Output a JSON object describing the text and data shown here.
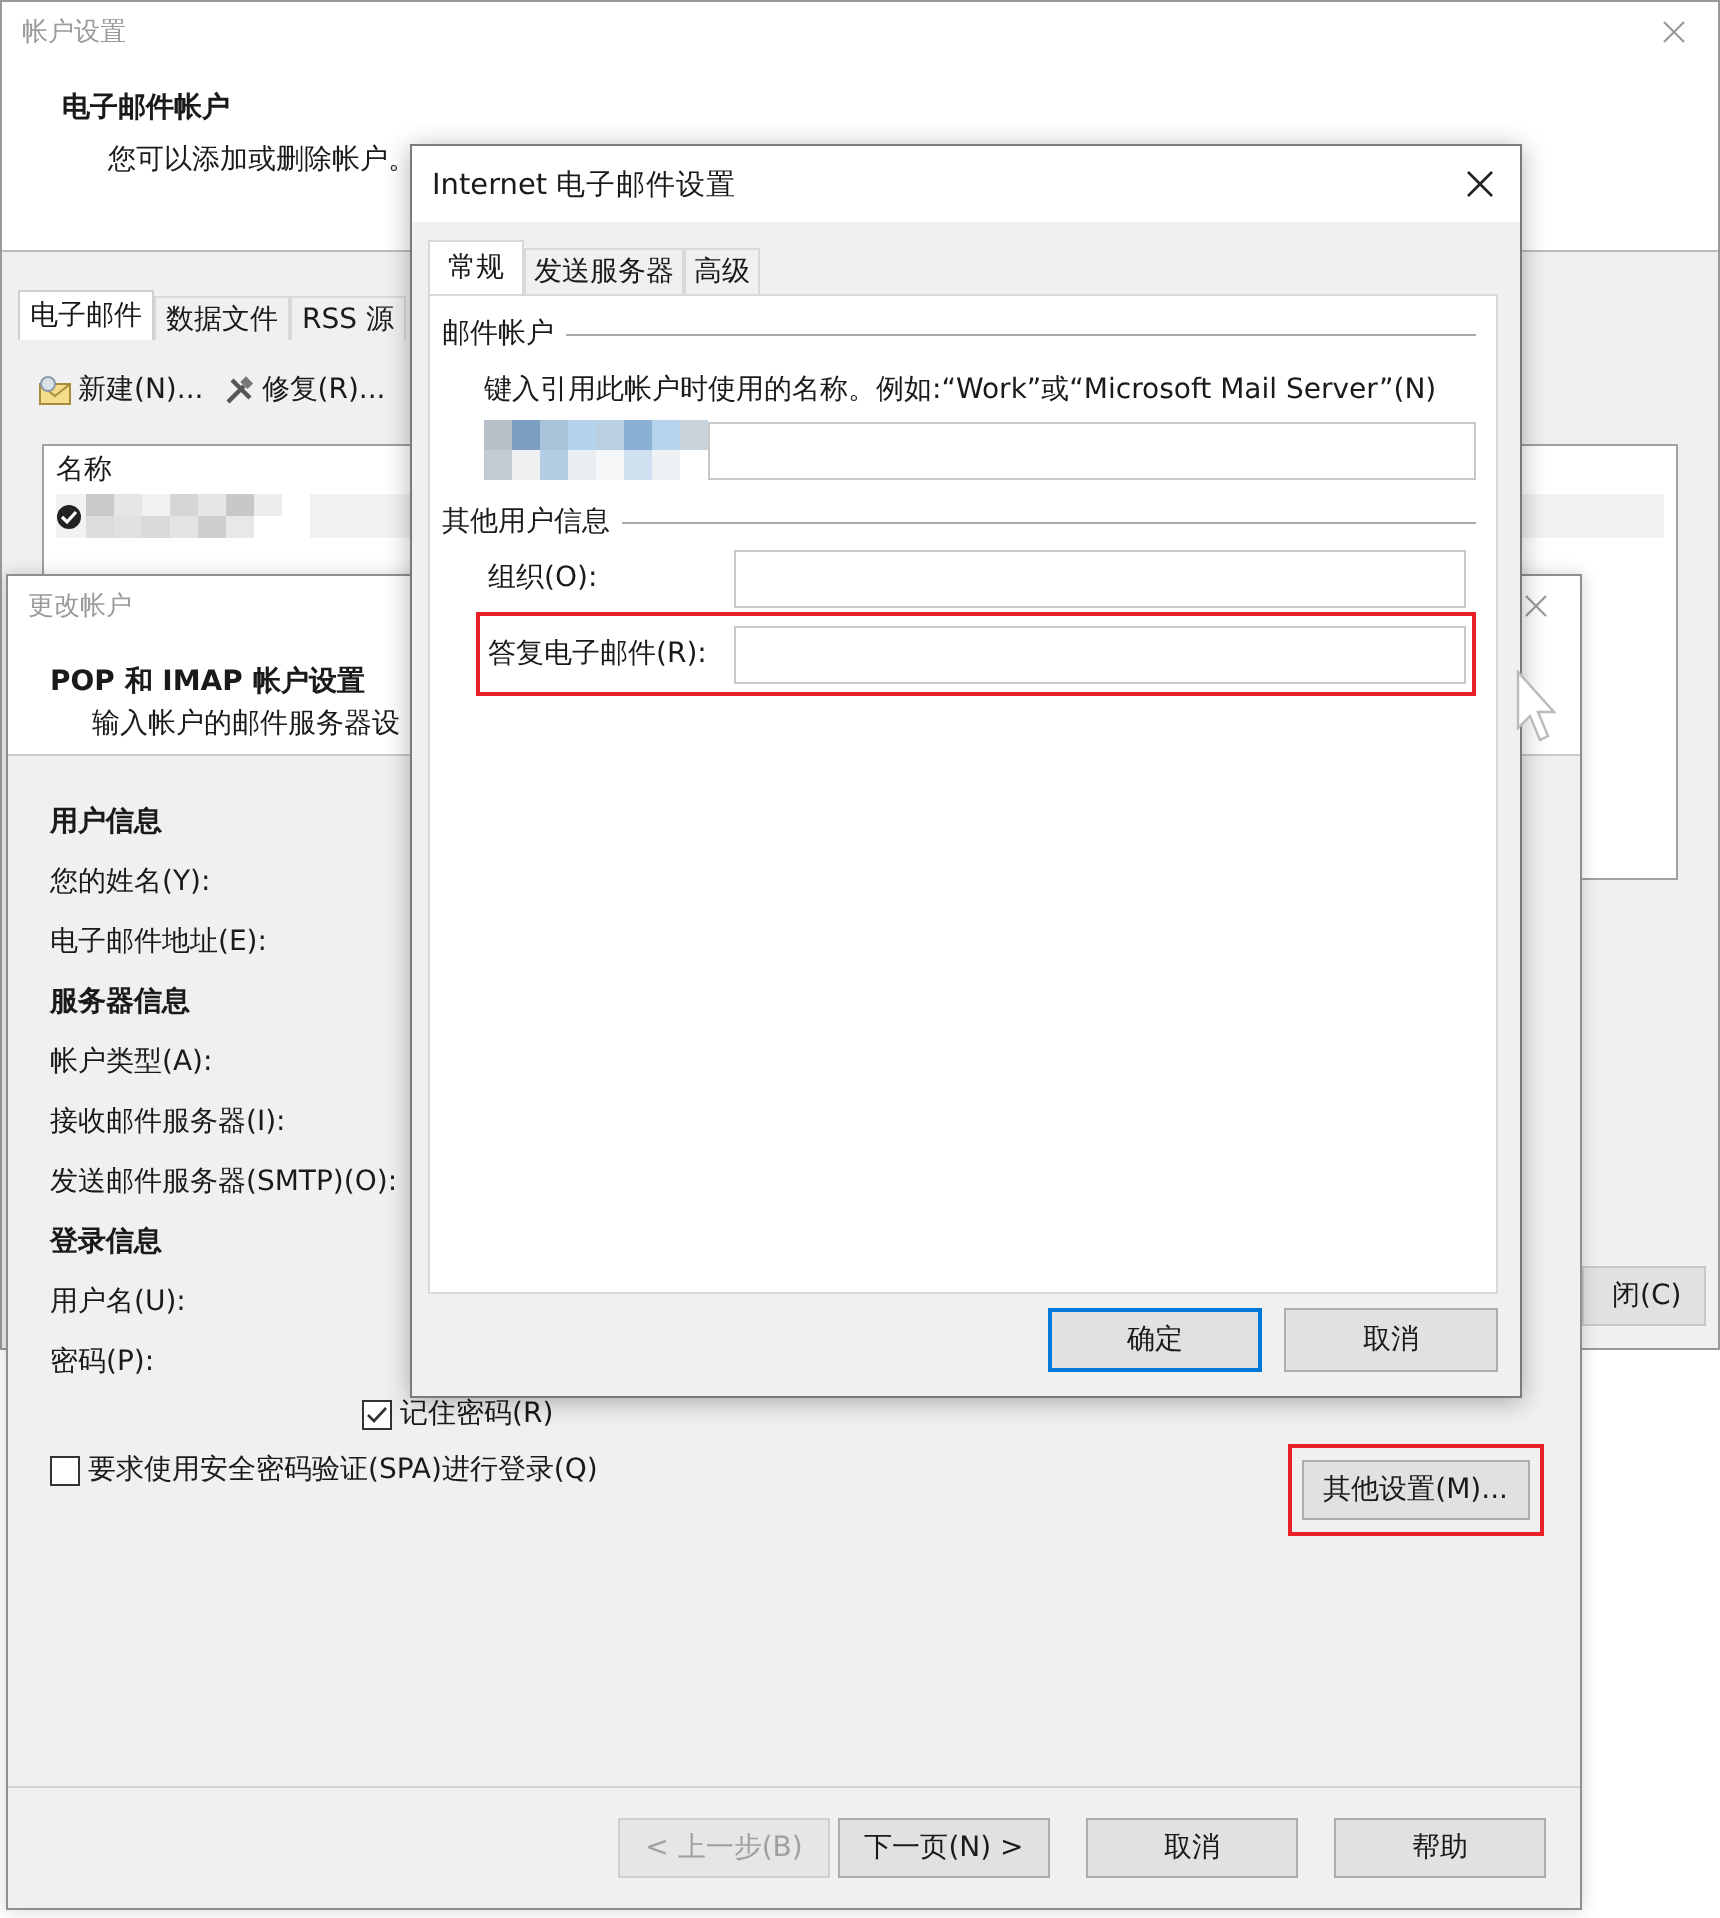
{
  "account_settings": {
    "title": "帐户设置",
    "heading": "电子邮件帐户",
    "subheading": "您可以添加或删除帐户。",
    "tabs": [
      {
        "label": "电子邮件",
        "selected": true
      },
      {
        "label": "数据文件",
        "selected": false
      },
      {
        "label": "RSS 源",
        "selected": false
      }
    ],
    "toolbar": [
      {
        "kind": "new",
        "label": "新建(N)..."
      },
      {
        "kind": "repair",
        "label": "修复(R)..."
      }
    ],
    "list": {
      "column": "名称",
      "rows": [
        {
          "default": true
        }
      ]
    },
    "close_button": "闭(C)"
  },
  "change_account": {
    "title": "更改帐户",
    "heading": "POP 和 IMAP 帐户设置",
    "subheading": "输入帐户的邮件服务器设",
    "fields": [
      {
        "kind": "section",
        "label": "用户信息"
      },
      {
        "kind": "label",
        "label": "您的姓名(Y):"
      },
      {
        "kind": "label",
        "label": "电子邮件地址(E):"
      },
      {
        "kind": "section",
        "label": "服务器信息"
      },
      {
        "kind": "label",
        "label": "帐户类型(A):"
      },
      {
        "kind": "label",
        "label": "接收邮件服务器(I):"
      },
      {
        "kind": "label",
        "label": "发送邮件服务器(SMTP)(O):"
      },
      {
        "kind": "section",
        "label": "登录信息"
      },
      {
        "kind": "label",
        "label": "用户名(U):"
      },
      {
        "kind": "label",
        "label": "密码(P):"
      }
    ],
    "remember_password": {
      "label": "记住密码(R)",
      "checked": true
    },
    "spa": {
      "label": "要求使用安全密码验证(SPA)进行登录(Q)",
      "checked": false
    },
    "more_settings": {
      "label": "其他设置(M)...",
      "highlighted": true
    },
    "buttons": [
      {
        "label": "< 上一步(B)",
        "disabled": true
      },
      {
        "label": "下一页(N) >",
        "disabled": false
      },
      {
        "label": "取消",
        "disabled": false
      },
      {
        "label": "帮助",
        "disabled": false
      }
    ]
  },
  "internet_email_settings": {
    "title": "Internet 电子邮件设置",
    "tabs": [
      {
        "label": "常规",
        "selected": true
      },
      {
        "label": "发送服务器",
        "selected": false
      },
      {
        "label": "高级",
        "selected": false
      }
    ],
    "mail_account": {
      "title": "邮件帐户",
      "prompt": "键入引用此帐户时使用的名称。例如:“Work”或“Microsoft Mail Server”(N)"
    },
    "other_info": {
      "title": "其他用户信息",
      "fields": [
        {
          "label": "组织(O):",
          "highlighted": false
        },
        {
          "label": "答复电子邮件(R):",
          "highlighted": true
        }
      ]
    },
    "buttons": [
      {
        "label": "确定",
        "default": true
      },
      {
        "label": "取消",
        "default": false
      }
    ]
  }
}
